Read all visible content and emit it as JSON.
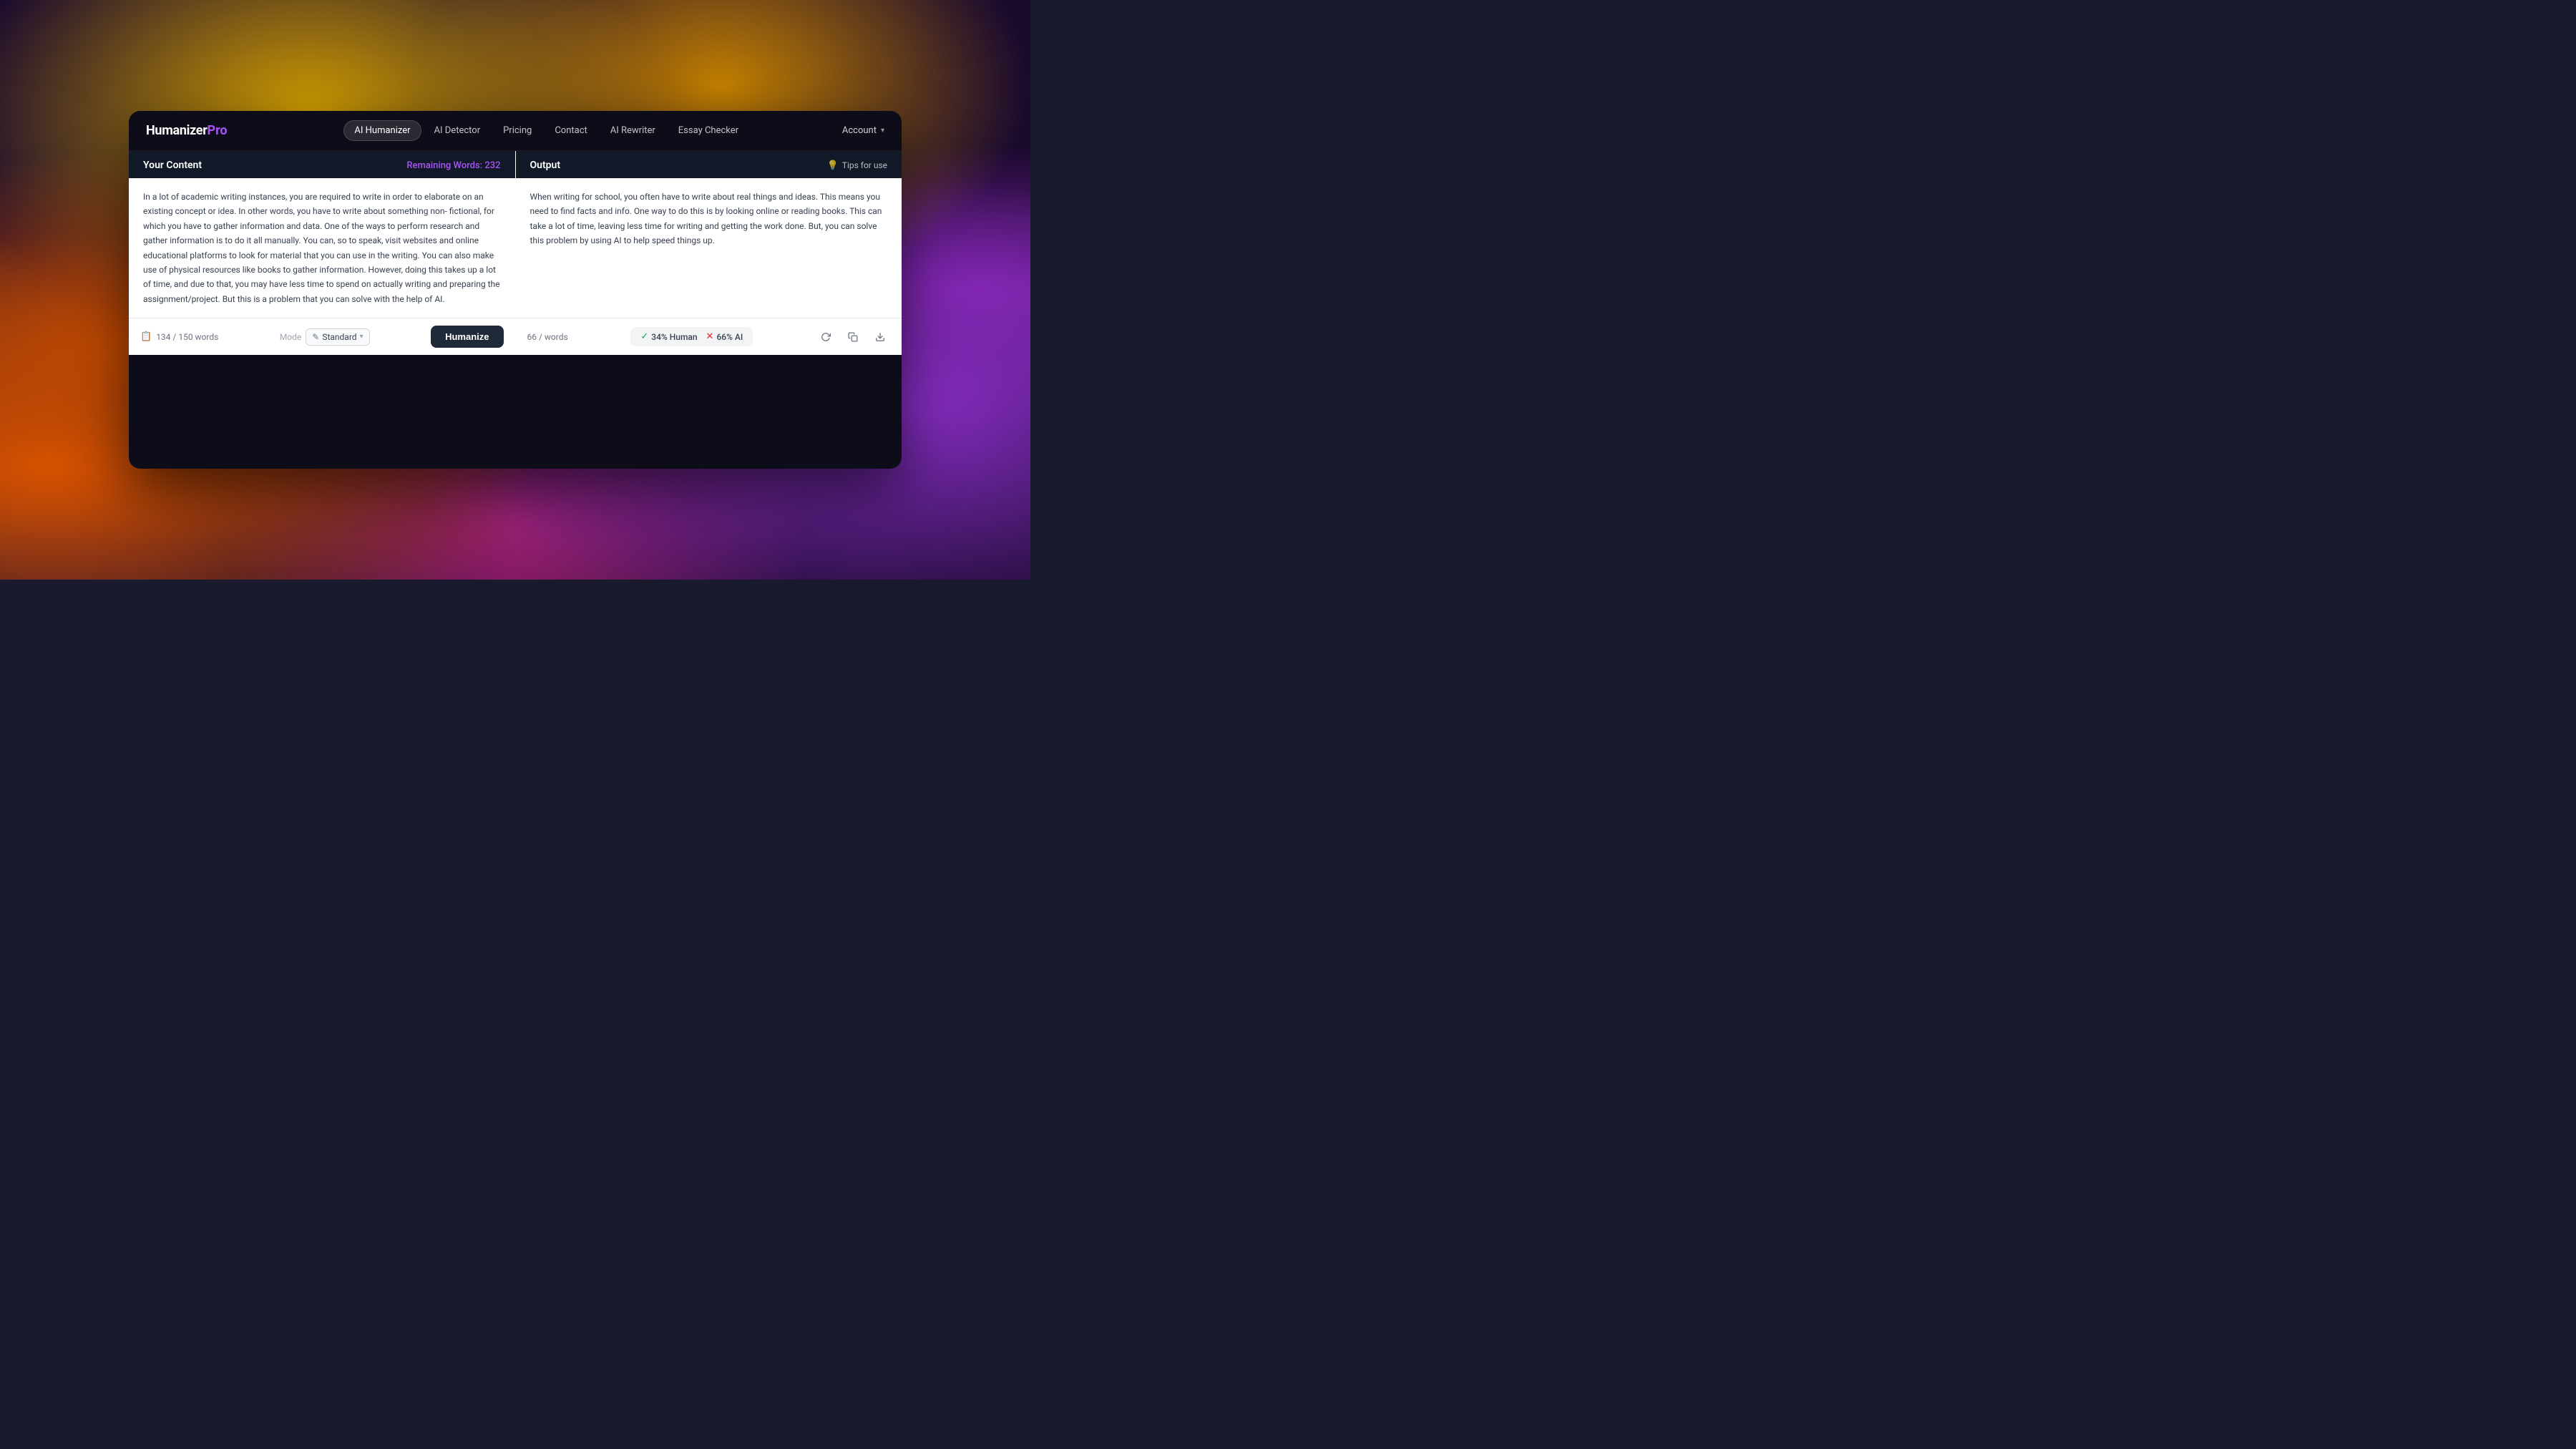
{
  "background": {},
  "navbar": {
    "logo": {
      "humanizer": "Humanizer",
      "pro": "Pro"
    },
    "nav_links": [
      {
        "id": "ai-humanizer",
        "label": "AI Humanizer",
        "active": true
      },
      {
        "id": "ai-detector",
        "label": "AI Detector",
        "active": false
      },
      {
        "id": "pricing",
        "label": "Pricing",
        "active": false
      },
      {
        "id": "contact",
        "label": "Contact",
        "active": false
      },
      {
        "id": "ai-rewriter",
        "label": "AI Rewriter",
        "active": false
      },
      {
        "id": "essay-checker",
        "label": "Essay Checker",
        "active": false
      }
    ],
    "account": {
      "label": "Account",
      "chevron": "▾"
    }
  },
  "left_panel": {
    "header": {
      "title": "Your Content",
      "remaining_label": "Remaining Words:",
      "remaining_count": "232"
    },
    "content": "In a lot of academic writing instances, you are required to write in order to elaborate on an existing concept or idea. In other words, you have to write about something non- fictional, for which you have to gather information and data.\nOne of the ways to perform research and gather information is to do it all manually. You can, so to speak, visit websites and online educational platforms to look for material that you can use in the writing. You can also make use of physical resources like books to gather information.\nHowever, doing this takes up a lot of time, and due to that, you may have less time to spend on actually writing and preparing the assignment/project. But this is a problem that you can solve with the help of AI.",
    "footer": {
      "word_count": "134 / 150 words",
      "mode_label": "Mode",
      "mode_icon": "✎",
      "mode_value": "Standard",
      "humanize_btn": "Humanize"
    }
  },
  "right_panel": {
    "header": {
      "title": "Output",
      "tips_icon": "💡",
      "tips_label": "Tips for use"
    },
    "content": "When writing for school, you often have to write about real things and ideas. This means you need to find facts and info. One way to do this is by looking online or reading books. This can take a lot of time, leaving less time for writing and getting the work done. But, you can solve this problem by using AI to help speed things up.",
    "footer": {
      "word_count": "66 / words",
      "human_percent": "34% Human",
      "ai_percent": "66% AI",
      "check": "✓",
      "x": "✕"
    }
  }
}
